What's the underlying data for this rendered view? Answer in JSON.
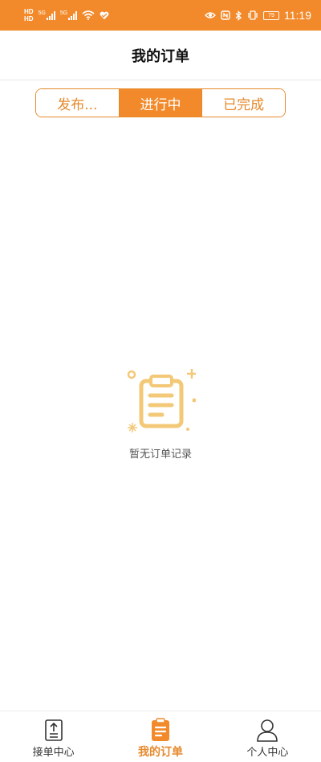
{
  "status_bar": {
    "network_left": "HD",
    "network_left2": "HD",
    "signal1_label": "5G",
    "signal2_label": "5G",
    "battery": "79",
    "time": "11:19"
  },
  "header": {
    "title": "我的订单"
  },
  "tabs": [
    {
      "label": "发布...",
      "active": false
    },
    {
      "label": "进行中",
      "active": true
    },
    {
      "label": "已完成",
      "active": false
    }
  ],
  "empty_state": {
    "text": "暂无订单记录"
  },
  "bottom_nav": [
    {
      "label": "接单中心",
      "icon": "upload-document-icon",
      "active": false
    },
    {
      "label": "我的订单",
      "icon": "clipboard-icon",
      "active": true
    },
    {
      "label": "个人中心",
      "icon": "person-icon",
      "active": false
    }
  ],
  "colors": {
    "accent": "#f28a2b",
    "accent_text": "#e5892b",
    "illustration": "#f3c877"
  }
}
